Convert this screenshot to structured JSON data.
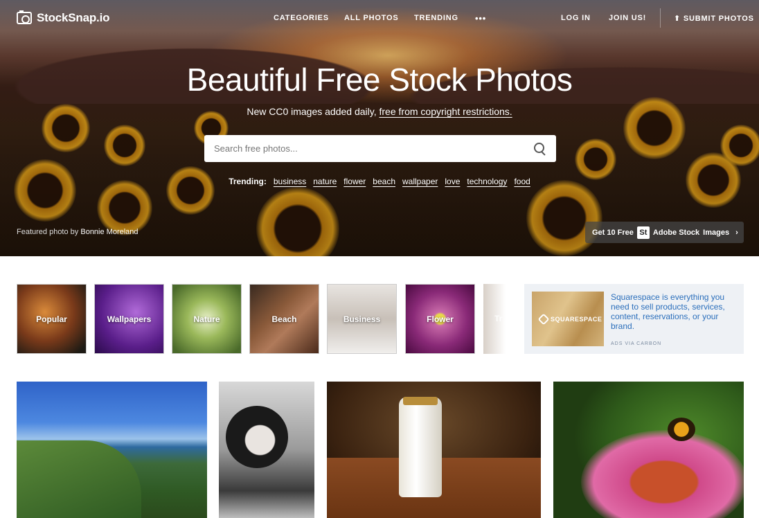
{
  "brand": {
    "name": "StockSnap.io"
  },
  "nav": {
    "categories": "CATEGORIES",
    "all_photos": "ALL PHOTOS",
    "trending": "TRENDING",
    "more": "•••",
    "login": "LOG IN",
    "join": "JOIN US!",
    "submit": "SUBMIT PHOTOS"
  },
  "hero": {
    "title": "Beautiful Free Stock Photos",
    "subtitle_prefix": "New CC0 images added daily,",
    "subtitle_link": "free from copyright restrictions.",
    "search_placeholder": "Search free photos...",
    "trending_label": "Trending:",
    "trending_tags": [
      "business",
      "nature",
      "flower",
      "beach",
      "wallpaper",
      "love",
      "technology",
      "food"
    ],
    "featured_prefix": "Featured photo by",
    "featured_author": "Bonnie Moreland",
    "adobe_prefix": "Get 10 Free",
    "adobe_badge": "St",
    "adobe_brand": "Adobe Stock",
    "adobe_suffix": "Images",
    "adobe_chevron": "›"
  },
  "categories": [
    "Popular",
    "Wallpapers",
    "Nature",
    "Beach",
    "Business",
    "Flower",
    "Tr"
  ],
  "ad": {
    "logo": "SQUARESPACE",
    "text": "Squarespace is everything you need to sell products, services, content, reservations, or your brand.",
    "via": "ADS VIA CARBON"
  },
  "colors": {
    "accent_link": "#2a6ebb",
    "ad_bg": "#eef1f5"
  }
}
